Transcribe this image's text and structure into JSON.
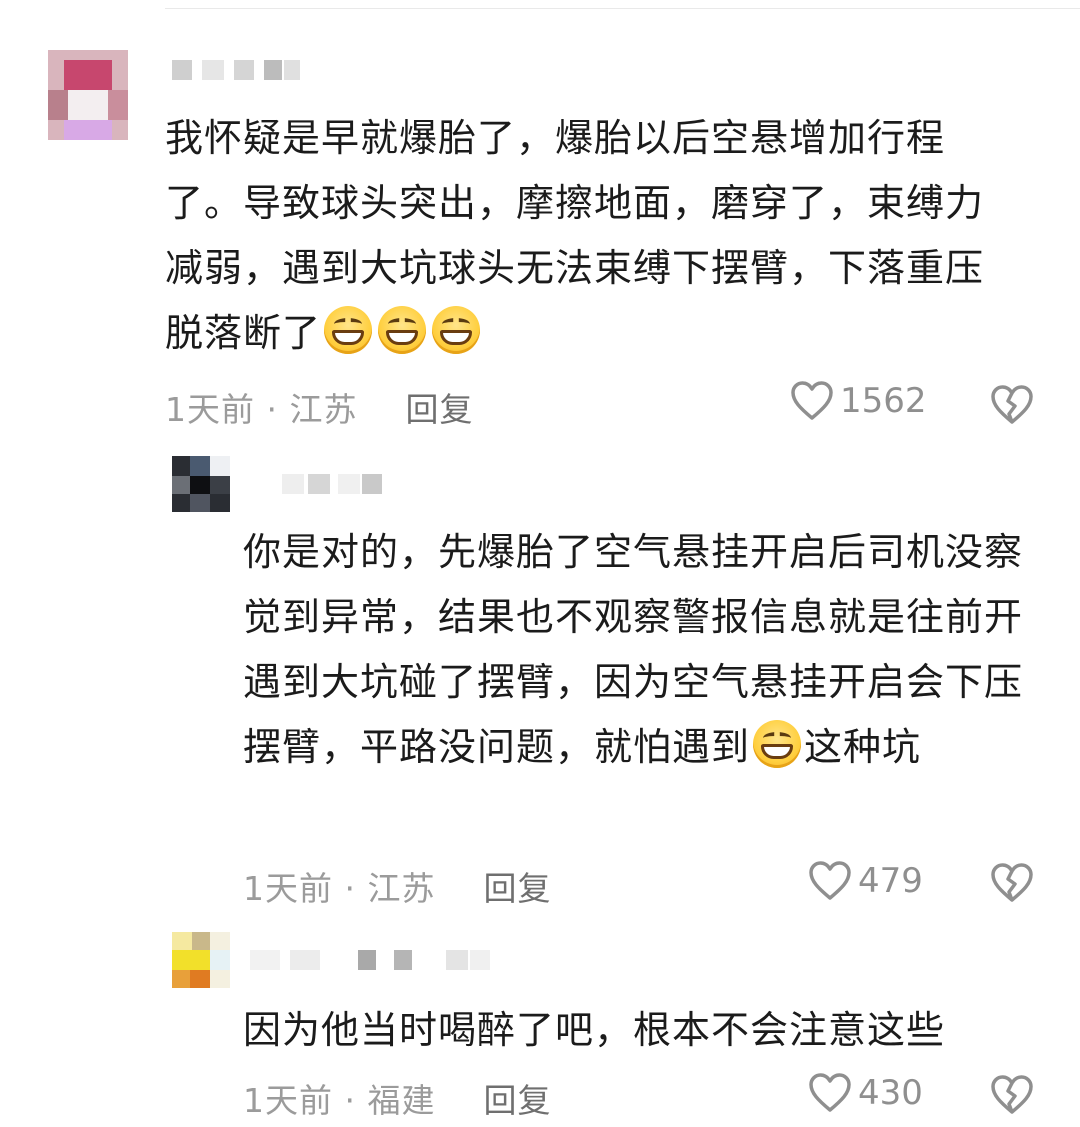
{
  "comments": [
    {
      "text_before": "我怀疑是早就爆胎了，爆胎以后空悬增加行程了。导致球头突出，摩擦地面，磨穿了，束缚力减弱，遇到大坑球头无法束缚下摆臂，下落重压脱落断了",
      "text_after": "",
      "emoji_count": 3,
      "time_location": "1天前 · 江苏",
      "reply_label": "回复",
      "likes": "1562"
    },
    {
      "text_before": "你是对的，先爆胎了空气悬挂开启后司机没察觉到异常，结果也不观察警报信息就是往前开遇到大坑碰了摆臂，因为空气悬挂开启会下压摆臂，平路没问题，就怕遇到",
      "text_after": "这种坑",
      "emoji_count": 1,
      "time_location": "1天前 · 江苏",
      "reply_label": "回复",
      "likes": "479"
    },
    {
      "text_before": "因为他当时喝醉了吧，根本不会注意这些",
      "text_after": "",
      "emoji_count": 0,
      "time_location": "1天前 · 福建",
      "reply_label": "回复",
      "likes": "430"
    }
  ],
  "icons": {
    "like": "heart-outline-icon",
    "dislike": "broken-heart-icon",
    "emoji": "grinning-face-emoji"
  },
  "colors": {
    "text": "#1b1b1b",
    "meta": "#9b9b9b",
    "reply": "#6f6f6f",
    "icon": "#8f8f8f"
  }
}
